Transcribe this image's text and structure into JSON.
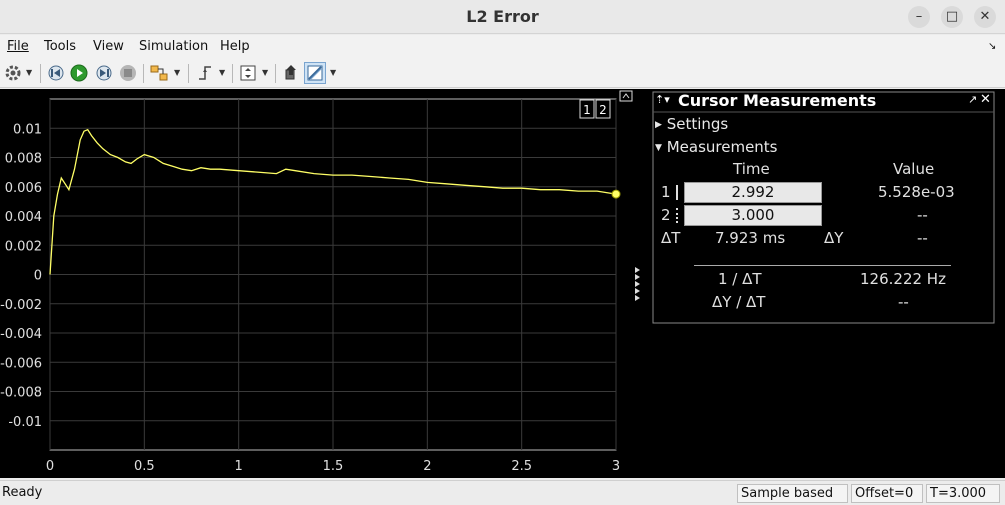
{
  "window": {
    "title": "L2 Error",
    "minimize_glyph": "–",
    "maximize_glyph": "□",
    "close_glyph": "✕"
  },
  "menu": [
    {
      "label": "File"
    },
    {
      "label": "Tools"
    },
    {
      "label": "View"
    },
    {
      "label": "Simulation"
    },
    {
      "label": "Help"
    }
  ],
  "toolbar": {
    "icons": [
      "gear-icon",
      "step-back-icon",
      "run-icon",
      "step-forward-icon",
      "stop-icon",
      "highlight-block-icon",
      "triggers-icon",
      "scale-axes-icon",
      "bring-to-front-icon",
      "cursor-measurements-icon"
    ]
  },
  "plot": {
    "layout_indicator": [
      "1",
      "2"
    ]
  },
  "cursor_panel": {
    "title": "Cursor Measurements",
    "settings_label": "Settings",
    "measurements_label": "Measurements",
    "col_time": "Time",
    "col_value": "Value",
    "cursor1_label": "1",
    "cursor1_time": "2.992",
    "cursor1_value": "5.528e-03",
    "cursor2_label": "2",
    "cursor2_time": "3.000",
    "cursor2_value": "--",
    "delta_t_label": "ΔT",
    "delta_t_value": "7.923 ms",
    "delta_y_label": "ΔY",
    "delta_y_value": "--",
    "inv_dt_label": "1 / ΔT",
    "inv_dt_value": "126.222 Hz",
    "dy_dt_label": "ΔY / ΔT",
    "dy_dt_value": "--"
  },
  "status": {
    "ready": "Ready",
    "mode": "Sample based",
    "offset": "Offset=0",
    "time": "T=3.000"
  },
  "colors": {
    "trace": "#ffff66",
    "grid": "#3a3a3a",
    "axes_text": "#e0e0e0",
    "background": "#000000"
  },
  "chart_data": {
    "type": "line",
    "title": "",
    "xlabel": "",
    "ylabel": "",
    "xlim": [
      0,
      3
    ],
    "ylim": [
      -0.012,
      0.012
    ],
    "xticks": [
      0,
      0.5,
      1,
      1.5,
      2,
      2.5,
      3
    ],
    "xtick_labels": [
      "0",
      "0.5",
      "1",
      "1.5",
      "2",
      "2.5",
      "3"
    ],
    "yticks": [
      0.01,
      0.008,
      0.006,
      0.004,
      0.002,
      0,
      -0.002,
      -0.004,
      -0.006,
      -0.008,
      -0.01
    ],
    "ytick_labels": [
      "0.01",
      "0.008",
      "0.006",
      "0.004",
      "0.002",
      "0",
      "-0.002",
      "-0.004",
      "-0.006",
      "-0.008",
      "-0.01"
    ],
    "grid": true,
    "series": [
      {
        "color": "#ffff66",
        "x": [
          0,
          0.02,
          0.04,
          0.06,
          0.08,
          0.1,
          0.13,
          0.16,
          0.18,
          0.2,
          0.22,
          0.25,
          0.28,
          0.32,
          0.36,
          0.4,
          0.43,
          0.46,
          0.5,
          0.55,
          0.6,
          0.65,
          0.7,
          0.75,
          0.8,
          0.85,
          0.9,
          1.0,
          1.1,
          1.2,
          1.25,
          1.3,
          1.4,
          1.5,
          1.6,
          1.7,
          1.8,
          1.9,
          2.0,
          2.1,
          2.2,
          2.3,
          2.4,
          2.5,
          2.6,
          2.7,
          2.8,
          2.9,
          3.0
        ],
        "y": [
          0.0,
          0.004,
          0.0055,
          0.0066,
          0.0062,
          0.0058,
          0.0072,
          0.0092,
          0.0098,
          0.0099,
          0.0095,
          0.009,
          0.0086,
          0.0082,
          0.008,
          0.0077,
          0.0076,
          0.0079,
          0.0082,
          0.008,
          0.0076,
          0.0074,
          0.0072,
          0.0071,
          0.0073,
          0.0072,
          0.0072,
          0.0071,
          0.007,
          0.0069,
          0.0072,
          0.0071,
          0.0069,
          0.0068,
          0.0068,
          0.0067,
          0.0066,
          0.0065,
          0.0063,
          0.0062,
          0.0061,
          0.006,
          0.0059,
          0.0059,
          0.0058,
          0.0058,
          0.0057,
          0.0057,
          0.0055
        ]
      }
    ],
    "cursor_marker": {
      "x": 3.0,
      "y": 0.0055
    }
  }
}
